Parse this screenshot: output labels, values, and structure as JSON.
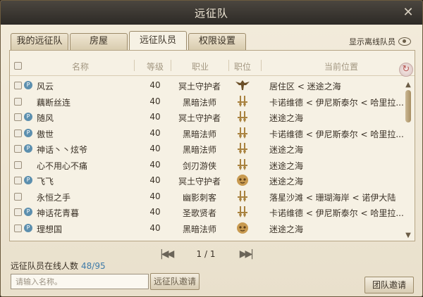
{
  "window": {
    "title": "远征队"
  },
  "tabs": [
    {
      "label": "我的远征队",
      "active": false
    },
    {
      "label": "房屋",
      "active": false
    },
    {
      "label": "远征队员",
      "active": true
    },
    {
      "label": "权限设置",
      "active": false
    }
  ],
  "show_offline_label": "显示离线队员",
  "table": {
    "headers": {
      "name": "名称",
      "level": "等级",
      "job": "职业",
      "position": "职位",
      "location": "当前位置"
    },
    "rows": [
      {
        "name": "风云",
        "online_badge": "P",
        "level": "40",
        "job": "冥土守护者",
        "rank_icon": "eagle-icon",
        "location": "居住区 < 迷途之海"
      },
      {
        "name": "藕断丝连",
        "online_badge": "",
        "level": "40",
        "job": "黑暗法师",
        "rank_icon": "dagger-pair-icon",
        "location": "卡诺维德 < 伊尼斯泰尔 < 哈里拉..."
      },
      {
        "name": "随风",
        "online_badge": "P",
        "level": "40",
        "job": "冥土守护者",
        "rank_icon": "dagger-pair-icon",
        "location": "迷途之海"
      },
      {
        "name": "傲世",
        "online_badge": "P",
        "level": "40",
        "job": "黑暗法师",
        "rank_icon": "dagger-pair-icon",
        "location": "卡诺维德 < 伊尼斯泰尔 < 哈里拉..."
      },
      {
        "name": "神话丶丶炫爷",
        "online_badge": "P",
        "level": "40",
        "job": "黑暗法师",
        "rank_icon": "dagger-pair-icon",
        "location": "迷途之海"
      },
      {
        "name": "心不用心不痛",
        "online_badge": "",
        "level": "40",
        "job": "剑刃游侠",
        "rank_icon": "dagger-pair-icon",
        "location": "迷途之海"
      },
      {
        "name": "飞飞",
        "online_badge": "P",
        "level": "40",
        "job": "冥土守护者",
        "rank_icon": "mask-icon",
        "location": "迷途之海"
      },
      {
        "name": "永恒之手",
        "online_badge": "",
        "level": "40",
        "job": "幽影刺客",
        "rank_icon": "dagger-pair-icon",
        "location": "落星沙滩 < 珊瑚海岸 < 诺伊大陆"
      },
      {
        "name": "神话花青暮",
        "online_badge": "P",
        "level": "40",
        "job": "圣歌贤者",
        "rank_icon": "dagger-pair-icon",
        "location": "卡诺维德 < 伊尼斯泰尔 < 哈里拉..."
      },
      {
        "name": "理想国",
        "online_badge": "P",
        "level": "40",
        "job": "黑暗法师",
        "rank_icon": "mask-icon",
        "location": "迷途之海"
      }
    ]
  },
  "pagination": {
    "text": "1 / 1"
  },
  "online": {
    "label": "远征队员在线人数",
    "value": "48/95"
  },
  "name_input": {
    "placeholder": "请输入名称。",
    "value": ""
  },
  "buttons": {
    "expedition_invite": "远征队邀请",
    "team_invite": "团队邀请"
  },
  "colors": {
    "accent_blue": "#3e7aa8",
    "title_bar": "#3a3631",
    "panel_bg": "#f6f1e4"
  }
}
